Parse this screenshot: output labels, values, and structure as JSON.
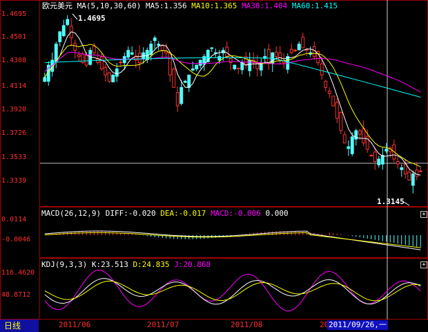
{
  "colors": {
    "up": "#52ffff",
    "down": "#ff3232",
    "ma5": "#ffffff",
    "ma10": "#ffff00",
    "ma30": "#ff00ff",
    "ma60": "#00ffff",
    "axis": "#ff3030",
    "tab_bg": "#1010a0"
  },
  "main": {
    "symbol": "欧元美元",
    "ma_label": "MA(5,10,30,60)",
    "ma5": "MA5:1.356",
    "ma10": "MA10:1.365",
    "ma30": "MA30:1.404",
    "ma60": "MA60:1.415",
    "yticks": [
      "1.4695",
      "1.4501",
      "1.4308",
      "1.4114",
      "1.3920",
      "1.3726",
      "1.3533",
      "1.3339"
    ],
    "high_label": "1.4695",
    "low_label": "1.3145"
  },
  "macd": {
    "title": "MACD(26,12,9)",
    "diff": "DIFF:-0.020",
    "dea": "DEA:-0.017",
    "macd": "MACD:-0.006",
    "extra": "0.000",
    "yticks": [
      "0.0114",
      "-0.0046"
    ]
  },
  "kdj": {
    "title": "KDJ(9,3,3)",
    "k": "K:23.513",
    "d": "D:24.835",
    "j": "J:20.868",
    "yticks": [
      "116.4620",
      "48.8712"
    ]
  },
  "footer": {
    "tab_label": "日线",
    "xticks": [
      "2011/06",
      "2011/07",
      "2011/08",
      "20"
    ],
    "crosshair_date": "2011/09/26,一"
  },
  "buttons": {
    "expand": "+",
    "expand2": "+"
  },
  "chart_data": [
    {
      "type": "candlestick",
      "title": "欧元美元",
      "ylim": [
        1.3145,
        1.4695
      ],
      "high": 1.4695,
      "low": 1.3145,
      "close": [
        1.418,
        1.428,
        1.432,
        1.445,
        1.455,
        1.46,
        1.465,
        1.45,
        1.44,
        1.435,
        1.43,
        1.428,
        1.44,
        1.438,
        1.43,
        1.425,
        1.42,
        1.415,
        1.42,
        1.425,
        1.43,
        1.435,
        1.44,
        1.438,
        1.432,
        1.43,
        1.438,
        1.44,
        1.445,
        1.45,
        1.445,
        1.44,
        1.438,
        1.42,
        1.41,
        1.395,
        1.41,
        1.415,
        1.42,
        1.425,
        1.428,
        1.432,
        1.435,
        1.44,
        1.442,
        1.438,
        1.435,
        1.44,
        1.435,
        1.43,
        1.428,
        1.425,
        1.43,
        1.428,
        1.432,
        1.43,
        1.425,
        1.43,
        1.435,
        1.43,
        1.438,
        1.435,
        1.432,
        1.43,
        1.435,
        1.438,
        1.44,
        1.445,
        1.442,
        1.44,
        1.438,
        1.435,
        1.43,
        1.42,
        1.41,
        1.405,
        1.395,
        1.385,
        1.375,
        1.365,
        1.362,
        1.37,
        1.375,
        1.372,
        1.365,
        1.36,
        1.355,
        1.35,
        1.352,
        1.355,
        1.36,
        1.358,
        1.352,
        1.348,
        1.345,
        1.34,
        1.335,
        1.34,
        1.338,
        1.342
      ],
      "ma5": 1.356,
      "ma10": 1.365,
      "ma30": 1.404,
      "ma60": 1.415
    },
    {
      "type": "bar",
      "title": "MACD(26,12,9)",
      "diff": -0.02,
      "dea": -0.017,
      "macd": -0.006,
      "ylim": [
        -0.0046,
        0.0114
      ]
    },
    {
      "type": "line",
      "title": "KDJ(9,3,3)",
      "k": 23.513,
      "d": 24.835,
      "j": 20.868,
      "ylim": [
        48.8712,
        116.462
      ]
    }
  ]
}
